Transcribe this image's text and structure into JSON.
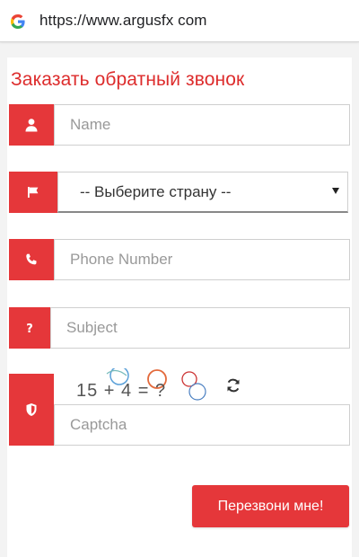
{
  "browser": {
    "url": "https://www.argusfx com",
    "favicon": "google-g-icon"
  },
  "form": {
    "title": "Заказать обратный звонок",
    "name_placeholder": "Name",
    "country_selected": "-- Выберите страну --",
    "phone_placeholder": "Phone Number",
    "subject_placeholder": "Subject",
    "captcha_expression": "15 + 4 = ?",
    "captcha_placeholder": "Captcha",
    "submit_label": "Перезвони мне!"
  },
  "icons": {
    "name": "user-icon",
    "country": "flag-icon",
    "phone": "phone-icon",
    "subject": "question-icon",
    "captcha": "shield-icon",
    "refresh": "refresh-icon"
  },
  "colors": {
    "accent": "#e5373a",
    "title": "#dd2c2c"
  }
}
